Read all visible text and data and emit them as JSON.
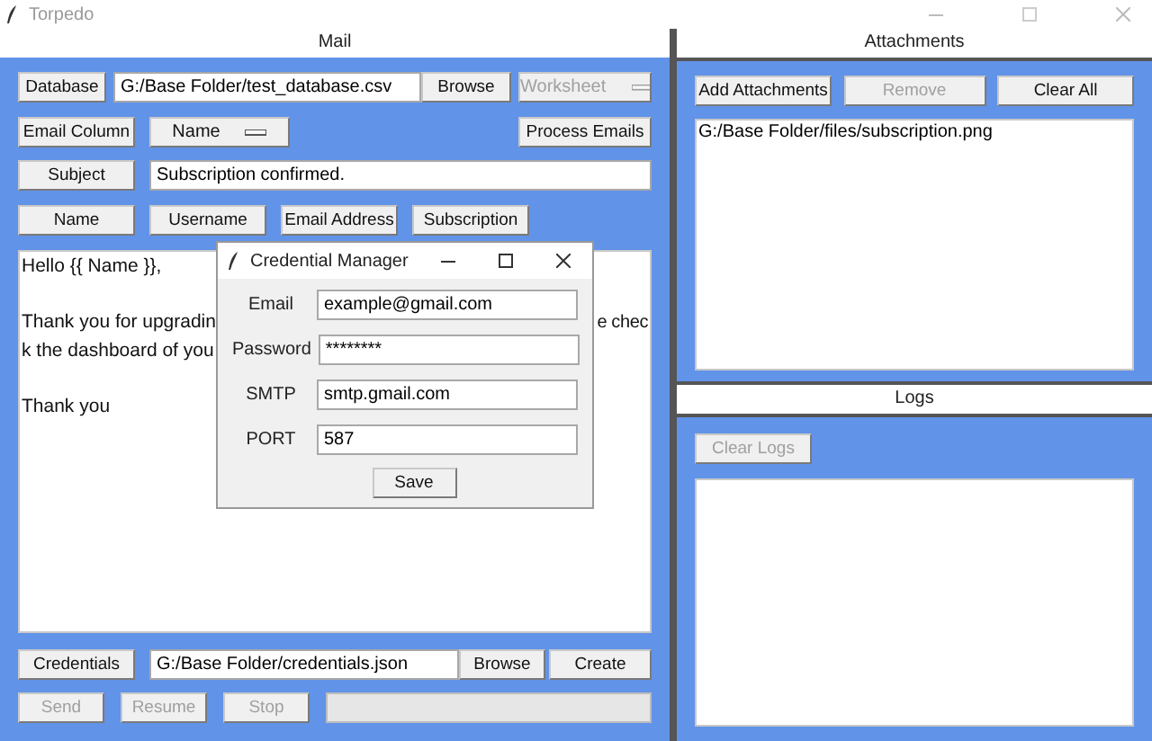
{
  "window": {
    "title": "Torpedo"
  },
  "mail": {
    "title": "Mail",
    "database": {
      "button": "Database",
      "path": "G:/Base Folder/test_database.csv",
      "browse": "Browse",
      "worksheet": {
        "value": "Worksheet",
        "disabled": true
      }
    },
    "email_column": {
      "button": "Email Column",
      "value": "Name",
      "disabled": false
    },
    "process_button": "Process Emails",
    "subject": {
      "button": "Subject",
      "value": "Subscription confirmed."
    },
    "fields": [
      "Name",
      "Username",
      "Email Address",
      "Subscription"
    ],
    "body": [
      {
        "lines": [
          {
            "left": "Hello {{ Name }},"
          }
        ]
      },
      {
        "lines": [
          {
            "left": "Thank you for upgradin",
            "right": "e chec"
          },
          {
            "left": "k the dashboard of you"
          }
        ]
      },
      {
        "lines": [
          {
            "left": "Thank you"
          }
        ]
      }
    ],
    "credentials": {
      "button": "Credentials",
      "path": "G:/Base Folder/credentials.json",
      "browse": "Browse",
      "create": "Create"
    },
    "actions": [
      {
        "label": "Send",
        "disabled": true
      },
      {
        "label": "Resume",
        "disabled": true
      },
      {
        "label": "Stop",
        "disabled": true
      }
    ],
    "progress": {
      "level": 0
    }
  },
  "attachments": {
    "title": "Attachments",
    "buttons": [
      {
        "label": "Add Attachments",
        "disabled": false
      },
      {
        "label": "Remove",
        "disabled": true
      },
      {
        "label": "Clear All",
        "disabled": false
      }
    ],
    "items": [
      "G:/Base Folder/files/subscription.png"
    ]
  },
  "logs": {
    "title": "Logs",
    "clear": {
      "label": "Clear Logs",
      "disabled": true
    }
  },
  "dialog": {
    "title": "Credential Manager",
    "fields": [
      {
        "label": "Email",
        "value": "example@gmail.com"
      },
      {
        "label": "Password",
        "value": "********"
      },
      {
        "label": "SMTP",
        "value": "smtp.gmail.com"
      },
      {
        "label": "PORT",
        "value": "587"
      }
    ],
    "save": "Save"
  }
}
